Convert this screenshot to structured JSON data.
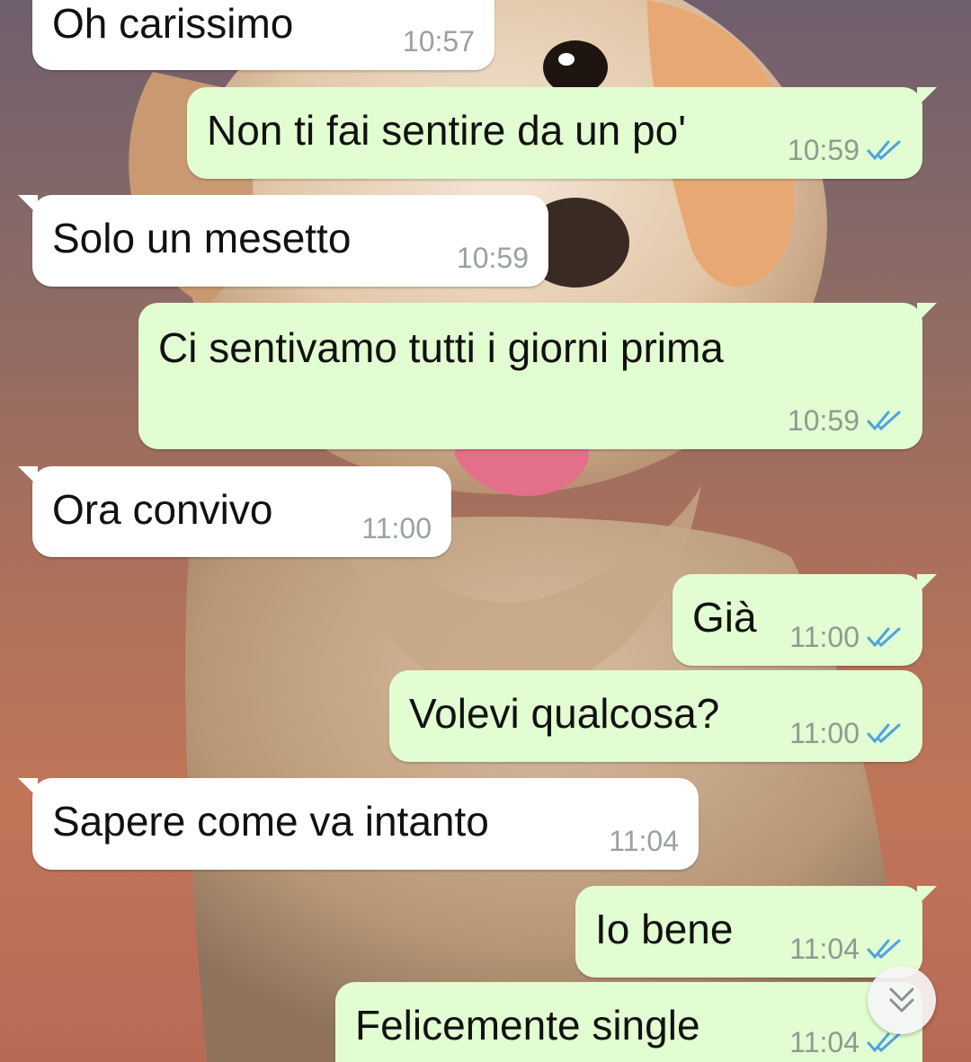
{
  "messages": [
    {
      "direction": "in",
      "text": "Oh carissimo",
      "time": "10:57"
    },
    {
      "direction": "out",
      "text": "Non ti fai sentire da un po'",
      "time": "10:59",
      "status": "read"
    },
    {
      "direction": "in",
      "text": "Solo un mesetto",
      "time": "10:59"
    },
    {
      "direction": "out",
      "text": "Ci sentivamo tutti i giorni prima",
      "time": "10:59",
      "status": "read"
    },
    {
      "direction": "in",
      "text": "Ora convivo",
      "time": "11:00"
    },
    {
      "direction": "out",
      "text": "Già",
      "time": "11:00",
      "status": "read"
    },
    {
      "direction": "out",
      "text": "Volevi qualcosa?",
      "time": "11:00",
      "status": "read"
    },
    {
      "direction": "in",
      "text": "Sapere come va intanto",
      "time": "11:04"
    },
    {
      "direction": "out",
      "text": "Io bene",
      "time": "11:04",
      "status": "read"
    },
    {
      "direction": "out",
      "text": "Felicemente single",
      "time": "11:04",
      "status": "read"
    }
  ],
  "scroll_button": {
    "icon": "double-chevron-down-icon"
  },
  "colors": {
    "incoming_bubble": "#ffffff",
    "outgoing_bubble": "#e2fdd1",
    "read_ticks": "#4fa3e0",
    "timestamp": "#8f9a92"
  },
  "wallpaper": {
    "subject": "golden retriever dog portrait on sunset background"
  }
}
